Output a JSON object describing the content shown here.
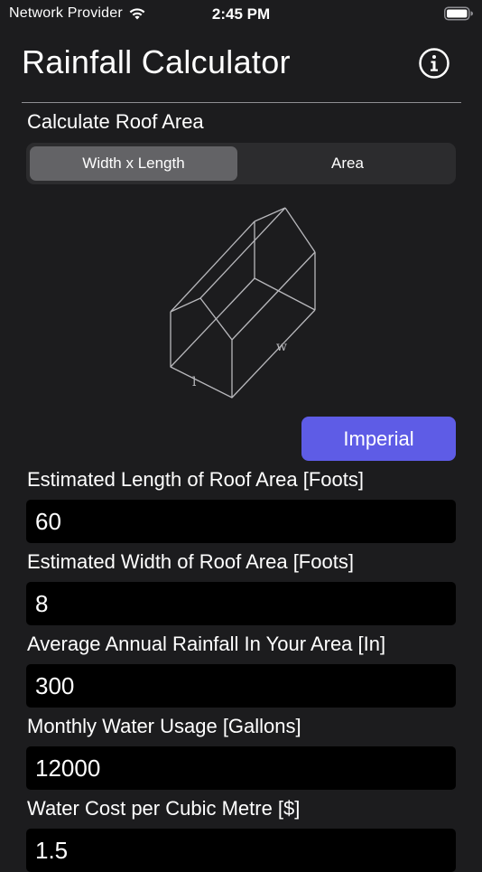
{
  "status_bar": {
    "carrier": "Network Provider",
    "time": "2:45 PM"
  },
  "header": {
    "title": "Rainfall Calculator",
    "info_icon": "info-circle-icon"
  },
  "roof_section": {
    "title": "Calculate Roof Area",
    "segments": [
      {
        "label": "Width x Length",
        "selected": true
      },
      {
        "label": "Area",
        "selected": false
      }
    ],
    "diagram_labels": {
      "width": "w",
      "length": "l"
    }
  },
  "units_button": {
    "label": "Imperial"
  },
  "fields": [
    {
      "label": "Estimated Length of Roof Area [Foots]",
      "value": "60"
    },
    {
      "label": "Estimated Width of Roof Area [Foots]",
      "value": "8"
    },
    {
      "label": "Average Annual Rainfall In Your Area [In]",
      "value": "300"
    },
    {
      "label": "Monthly Water Usage [Gallons]",
      "value": "12000"
    },
    {
      "label": "Water Cost per Cubic Metre [$]",
      "value": "1.5"
    }
  ],
  "colors": {
    "background": "#1c1c1e",
    "accent": "#5e5ce6",
    "segment_selected": "#636366",
    "input_background": "#000000"
  }
}
